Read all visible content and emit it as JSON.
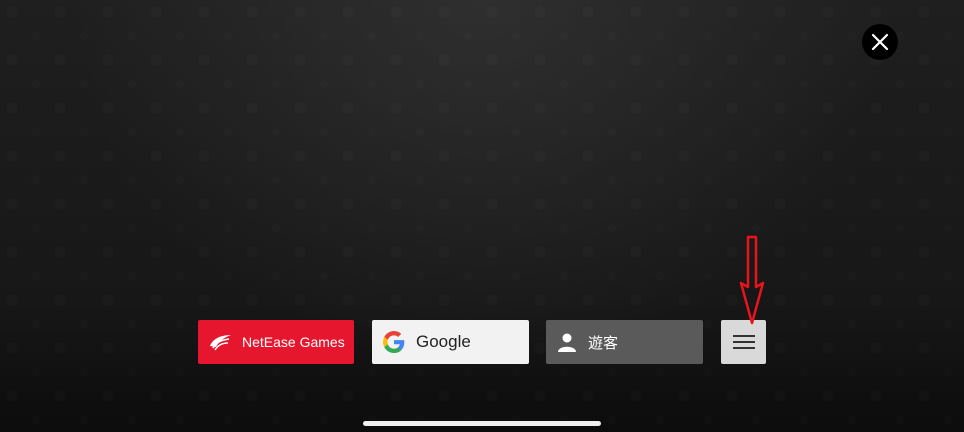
{
  "login": {
    "netease_label": "NetEase Games",
    "google_label": "Google",
    "guest_label": "遊客"
  },
  "icons": {
    "close": "close-icon",
    "netease": "netease-logo-icon",
    "google": "google-g-icon",
    "guest": "user-icon",
    "menu": "hamburger-menu-icon",
    "annotation": "red-down-arrow-annotation"
  },
  "colors": {
    "netease_red": "#e5162d",
    "google_bg": "#f2f2f2",
    "guest_bg": "#5a5a5a",
    "menu_bg": "#d9d9d9",
    "annotation_red": "#e8141c"
  }
}
